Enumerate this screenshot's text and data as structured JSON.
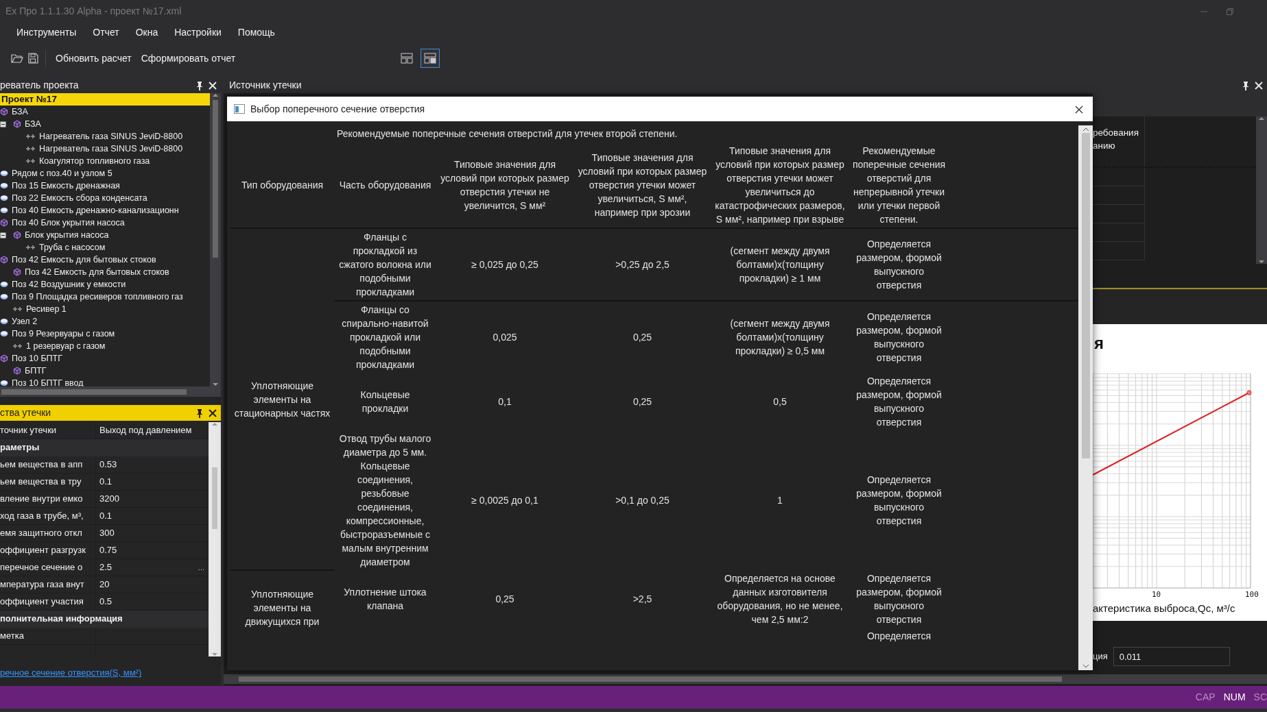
{
  "window": {
    "title": "Ex Про 1.1.1.30 Alpha - проект №17.xml"
  },
  "menu": [
    "Инструменты",
    "Отчет",
    "Окна",
    "Настройки",
    "Помощь"
  ],
  "toolbar": {
    "actions": [
      "Обновить расчет",
      "Сформировать отчет"
    ],
    "layout_toggles": [
      {
        "selected": false
      },
      {
        "selected": true
      }
    ]
  },
  "project_explorer": {
    "title": "реватель проекта",
    "tree": [
      {
        "label": "Проект №17",
        "kind": "project",
        "selected": true,
        "children": [
          {
            "label": "БЗА",
            "kind": "group",
            "selected": false,
            "children": [
              {
                "label": "БЗА",
                "kind": "group",
                "selected": false,
                "expanded": true,
                "children": [
                  {
                    "label": "Нагреватель газа SINUS JeviD-8800",
                    "kind": "element",
                    "selected": false
                  },
                  {
                    "label": "Нагреватель газа SINUS JeviD-8800",
                    "kind": "element",
                    "selected": false
                  },
                  {
                    "label": "Коагулятор топливного газа",
                    "kind": "element",
                    "selected": false
                  }
                ]
              }
            ]
          },
          {
            "label": "Рядом с поз.40 и узлом 5",
            "kind": "unit",
            "selected": false
          },
          {
            "label": "Поз 15 Емкость дренажная",
            "kind": "unit",
            "selected": false
          },
          {
            "label": "Поз 22 Емкость сбора конденсата",
            "kind": "unit",
            "selected": false
          },
          {
            "label": "Поз 40 Емкость дренажно-канализационн",
            "kind": "unit",
            "selected": false
          },
          {
            "label": "Поз 40 Блок укрытия насоса",
            "kind": "group",
            "selected": false,
            "children": [
              {
                "label": "Блок укрытия насоса",
                "kind": "group",
                "selected": false,
                "expanded": true,
                "children": [
                  {
                    "label": "Труба с насосом",
                    "kind": "element",
                    "selected": false
                  }
                ]
              }
            ]
          },
          {
            "label": "Поз 42 Емкость для бытовых стоков",
            "kind": "group",
            "selected": false,
            "children": [
              {
                "label": "Поз 42 Емкость для бытовых стоков",
                "kind": "group",
                "selected": false
              }
            ]
          },
          {
            "label": "Поз 42 Воздушник у емкости",
            "kind": "unit",
            "selected": false
          },
          {
            "label": "Поз 9 Площадка ресиверов топливного газ",
            "kind": "unit",
            "selected": false,
            "children": [
              {
                "label": "Ресивер 1",
                "kind": "element",
                "selected": false
              }
            ]
          },
          {
            "label": "Узел 2",
            "kind": "unit",
            "selected": false
          },
          {
            "label": "Поз 9 Резервуары с газом",
            "kind": "unit",
            "selected": false,
            "children": [
              {
                "label": "1 резервуар с газом",
                "kind": "element",
                "selected": false
              }
            ]
          },
          {
            "label": "Поз 10 БПТГ",
            "kind": "group",
            "selected": false,
            "children": [
              {
                "label": "БПТГ",
                "kind": "group",
                "selected": false
              }
            ]
          },
          {
            "label": "Поз 10 БПТГ ввод",
            "kind": "unit",
            "selected": false
          }
        ]
      }
    ]
  },
  "properties": {
    "title": "ства утечки",
    "rows": [
      {
        "kind": "property",
        "name": "точник утечки",
        "value": "Выход под давлением"
      },
      {
        "kind": "category",
        "name": "раметры"
      },
      {
        "kind": "property",
        "name": "ьем вещества в апп",
        "value": "0.53"
      },
      {
        "kind": "property",
        "name": "ьем вещества в тру",
        "value": "0.1"
      },
      {
        "kind": "property",
        "name": "вление внутри емко",
        "value": "3200"
      },
      {
        "kind": "property",
        "name": "ход газа в трубе, м³,",
        "value": "0.1"
      },
      {
        "kind": "property",
        "name": "емя защитного откл",
        "value": "300"
      },
      {
        "kind": "property",
        "name": "оффициент разгрузк",
        "value": "0.75"
      },
      {
        "kind": "property",
        "name": "перечное сечение о",
        "value": "2.5",
        "button": "..."
      },
      {
        "kind": "property",
        "name": "мпература газа внут",
        "value": "20"
      },
      {
        "kind": "property",
        "name": "оффициент участия",
        "value": "0.5"
      },
      {
        "kind": "category",
        "name": "полнительная информация"
      },
      {
        "kind": "property",
        "name": "метка"
      }
    ],
    "description_link": "речное сечение отверстия(S, мм²)"
  },
  "document": {
    "title": "Источник утечки",
    "header_lines": [
      "ребования",
      "анию"
    ],
    "chart": {
      "title": "я",
      "tick_labels": [
        "10",
        "100"
      ],
      "axis_label": "актеристика выброса,Qc, м³/с"
    },
    "field": {
      "label": "ция",
      "value": "0.011"
    }
  },
  "dialog": {
    "title": "Выбор поперечного сечение отверстия",
    "caption": "Рекомендуемые поперечные сечения отверстий для утечек второй степени.",
    "columns": [
      "Тип оборудования",
      "Часть оборудования",
      "Типовые значения для условий при которых размер отверстия утечки не увеличится, S мм²",
      "Типовые значения для условий при которых размер отверстия утечки может увеличиться, S мм², например при эрозии",
      "Типовые значения для условий при которых размер отверстия утечки может увеличиться до катастрофических размеров, S мм², например  при взрыве",
      "Рекомендуемые поперечные сечения отверстий для непрерывной утечки или утечки первой степени."
    ],
    "groups": [
      {
        "type": "Уплотняющие элементы на стационарных частях",
        "rows": [
          [
            "Фланцы с прокладкой из сжатого волокна или подобными прокладками",
            "≥ 0,025 до 0,25",
            ">0,25 до 2,5",
            "(сегмент между двумя болтами)x(толщину прокладки) ≥  1 мм",
            "Определяется размером, формой выпускного отверстия"
          ],
          [
            "Фланцы со спирально-навитой прокладкой или подобными прокладками",
            "0,025",
            "0,25",
            "(сегмент между двумя болтами)x(толщину прокладки) ≥  0,5 мм",
            "Определяется размером, формой выпускного отверстия"
          ],
          [
            "Кольцевые прокладки",
            "0,1",
            "0,25",
            "0,5",
            "Определяется размером, формой выпускного отверстия"
          ],
          [
            "Отвод трубы малого диаметра до 5 мм. Кольцевые соединения, резьбовые соединения, компрессионные, быстроразъемные с малым внутренним диаметром",
            "≥ 0,0025 до 0,1",
            ">0,1 до 0,25",
            "1",
            "Определяется размером, формой выпускного отверстия"
          ]
        ]
      },
      {
        "type": "Уплотняющие элементы на движущихся при",
        "rows": [
          [
            "Уплотнение штока клапана",
            "0,25",
            ">2,5",
            "Определяется на основе данных изготовителя оборудования, но не менее, чем 2,5 мм:2",
            "Определяется размером, формой выпускного отверстия"
          ],
          [
            "",
            "",
            "",
            "",
            "Определяется"
          ]
        ]
      }
    ]
  },
  "status_bar": [
    {
      "text": "CAP",
      "on": false
    },
    {
      "text": "NUM",
      "on": true
    },
    {
      "text": "SC",
      "on": false
    }
  ]
}
